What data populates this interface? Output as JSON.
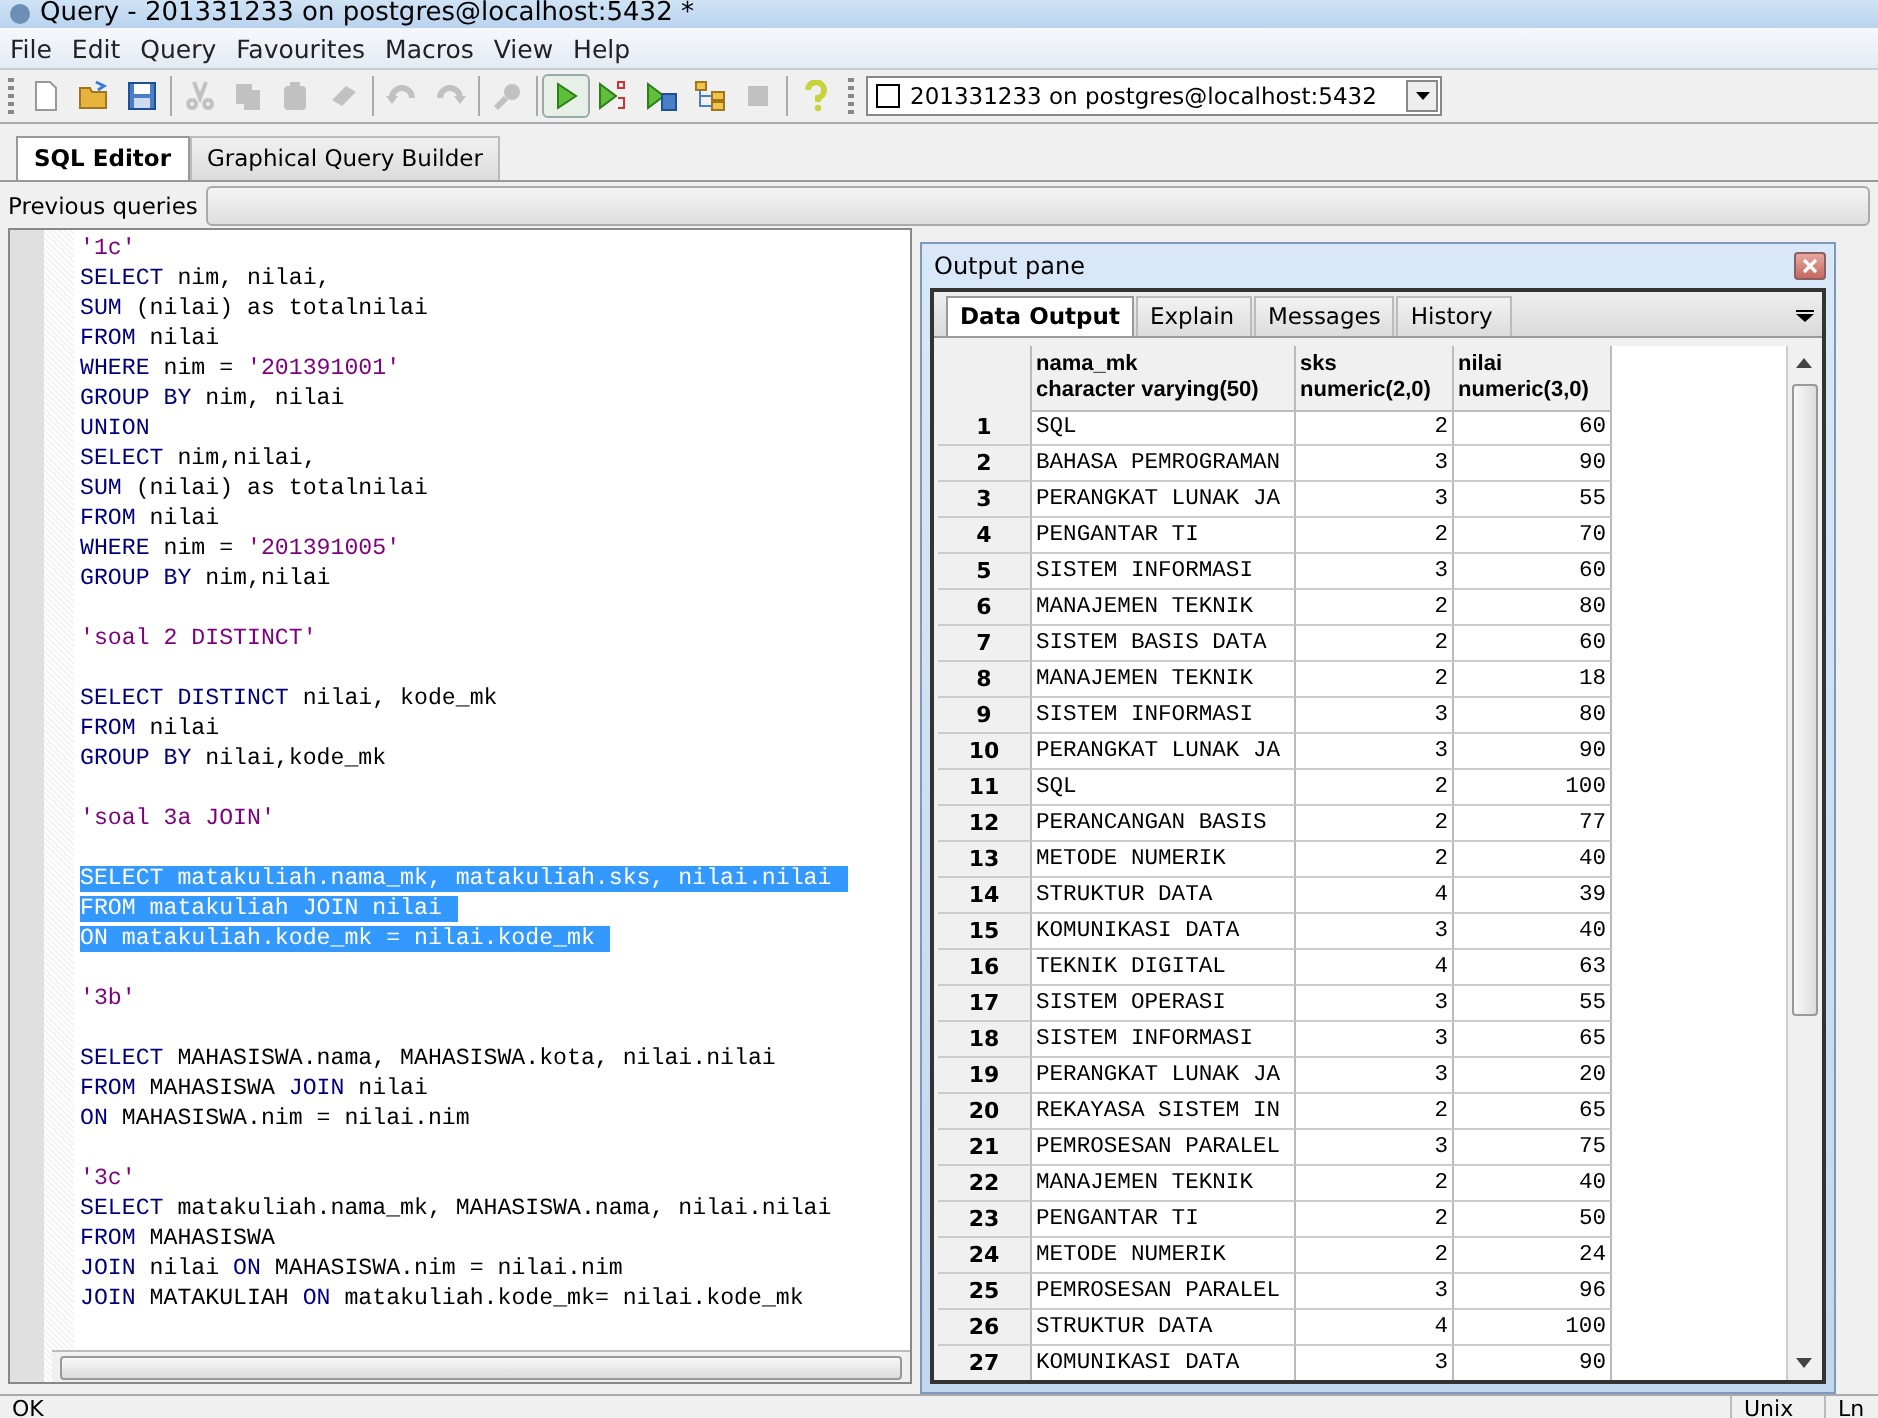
{
  "window": {
    "title": "Query - 201331233 on postgres@localhost:5432 *"
  },
  "menu": [
    "File",
    "Edit",
    "Query",
    "Favourites",
    "Macros",
    "View",
    "Help"
  ],
  "toolbar": [
    {
      "kind": "new",
      "disabled": false
    },
    {
      "kind": "open",
      "disabled": false
    },
    {
      "kind": "save",
      "disabled": false
    },
    {
      "kind": "sep"
    },
    {
      "kind": "cut",
      "disabled": true
    },
    {
      "kind": "copy",
      "disabled": true
    },
    {
      "kind": "paste",
      "disabled": true
    },
    {
      "kind": "clear",
      "disabled": true
    },
    {
      "kind": "sep"
    },
    {
      "kind": "undo",
      "disabled": true
    },
    {
      "kind": "redo",
      "disabled": true
    },
    {
      "kind": "sep"
    },
    {
      "kind": "find",
      "disabled": true
    },
    {
      "kind": "sep"
    },
    {
      "kind": "execute",
      "disabled": false
    },
    {
      "kind": "execute-pgs",
      "disabled": false
    },
    {
      "kind": "execute-file",
      "disabled": false
    },
    {
      "kind": "explain",
      "disabled": false
    },
    {
      "kind": "stop",
      "disabled": true
    },
    {
      "kind": "sep"
    },
    {
      "kind": "help",
      "disabled": false
    }
  ],
  "connection": {
    "value": "201331233 on postgres@localhost:5432"
  },
  "editor_tabs": [
    {
      "label": "SQL Editor",
      "selected": true
    },
    {
      "label": "Graphical Query Builder",
      "selected": false
    }
  ],
  "previous_queries": {
    "label": "Previous queries"
  },
  "code_lines": [
    {
      "kind": "code",
      "selected": false,
      "parts": [
        {
          "kind": "string",
          "text": "'1c'"
        }
      ]
    },
    {
      "kind": "code",
      "selected": false,
      "parts": [
        {
          "kind": "keyword",
          "text": "SELECT"
        },
        {
          "kind": "ident",
          "text": " nim, nilai,"
        }
      ]
    },
    {
      "kind": "code",
      "selected": false,
      "parts": [
        {
          "kind": "keyword",
          "text": "SUM"
        },
        {
          "kind": "ident",
          "text": " (nilai) as totalnilai"
        }
      ]
    },
    {
      "kind": "code",
      "selected": false,
      "parts": [
        {
          "kind": "keyword",
          "text": "FROM"
        },
        {
          "kind": "ident",
          "text": " nilai"
        }
      ]
    },
    {
      "kind": "code",
      "selected": false,
      "parts": [
        {
          "kind": "keyword",
          "text": "WHERE"
        },
        {
          "kind": "ident",
          "text": " nim = "
        },
        {
          "kind": "string",
          "text": "'201391001'"
        }
      ]
    },
    {
      "kind": "code",
      "selected": false,
      "parts": [
        {
          "kind": "keyword",
          "text": "GROUP BY"
        },
        {
          "kind": "ident",
          "text": " nim, nilai"
        }
      ]
    },
    {
      "kind": "code",
      "selected": false,
      "parts": [
        {
          "kind": "keyword",
          "text": "UNION"
        }
      ]
    },
    {
      "kind": "code",
      "selected": false,
      "parts": [
        {
          "kind": "keyword",
          "text": "SELECT"
        },
        {
          "kind": "ident",
          "text": " nim,nilai,"
        }
      ]
    },
    {
      "kind": "code",
      "selected": false,
      "parts": [
        {
          "kind": "keyword",
          "text": "SUM"
        },
        {
          "kind": "ident",
          "text": " (nilai) as totalnilai"
        }
      ]
    },
    {
      "kind": "code",
      "selected": false,
      "parts": [
        {
          "kind": "keyword",
          "text": "FROM"
        },
        {
          "kind": "ident",
          "text": " nilai"
        }
      ]
    },
    {
      "kind": "code",
      "selected": false,
      "parts": [
        {
          "kind": "keyword",
          "text": "WHERE"
        },
        {
          "kind": "ident",
          "text": " nim = "
        },
        {
          "kind": "string",
          "text": "'201391005'"
        }
      ]
    },
    {
      "kind": "code",
      "selected": false,
      "parts": [
        {
          "kind": "keyword",
          "text": "GROUP BY"
        },
        {
          "kind": "ident",
          "text": " nim,nilai"
        }
      ]
    },
    {
      "kind": "blank"
    },
    {
      "kind": "code",
      "selected": false,
      "parts": [
        {
          "kind": "string",
          "text": "'soal 2 DISTINCT'"
        }
      ]
    },
    {
      "kind": "blank"
    },
    {
      "kind": "code",
      "selected": false,
      "parts": [
        {
          "kind": "keyword",
          "text": "SELECT DISTINCT"
        },
        {
          "kind": "ident",
          "text": " nilai, kode_mk"
        }
      ]
    },
    {
      "kind": "code",
      "selected": false,
      "parts": [
        {
          "kind": "keyword",
          "text": "FROM"
        },
        {
          "kind": "ident",
          "text": " nilai"
        }
      ]
    },
    {
      "kind": "code",
      "selected": false,
      "parts": [
        {
          "kind": "keyword",
          "text": "GROUP BY"
        },
        {
          "kind": "ident",
          "text": " nilai,kode_mk"
        }
      ]
    },
    {
      "kind": "blank"
    },
    {
      "kind": "code",
      "selected": false,
      "parts": [
        {
          "kind": "string",
          "text": "'soal 3a JOIN'"
        }
      ]
    },
    {
      "kind": "blank"
    },
    {
      "kind": "code",
      "selected": true,
      "parts": [
        {
          "kind": "keyword",
          "text": "SELECT"
        },
        {
          "kind": "ident",
          "text": " matakuliah.nama_mk, matakuliah.sks, nilai.nilai"
        }
      ]
    },
    {
      "kind": "code",
      "selected": true,
      "parts": [
        {
          "kind": "keyword",
          "text": "FROM"
        },
        {
          "kind": "ident",
          "text": " matakuliah "
        },
        {
          "kind": "keyword",
          "text": "JOIN"
        },
        {
          "kind": "ident",
          "text": " nilai"
        }
      ]
    },
    {
      "kind": "code",
      "selected": true,
      "parts": [
        {
          "kind": "keyword",
          "text": "ON"
        },
        {
          "kind": "ident",
          "text": " matakuliah.kode_mk = nilai.kode_mk"
        }
      ]
    },
    {
      "kind": "blank"
    },
    {
      "kind": "code",
      "selected": false,
      "parts": [
        {
          "kind": "string",
          "text": "'3b'"
        }
      ]
    },
    {
      "kind": "blank"
    },
    {
      "kind": "code",
      "selected": false,
      "parts": [
        {
          "kind": "keyword",
          "text": "SELECT"
        },
        {
          "kind": "ident",
          "text": " MAHASISWA.nama, MAHASISWA.kota, nilai.nilai"
        }
      ]
    },
    {
      "kind": "code",
      "selected": false,
      "parts": [
        {
          "kind": "keyword",
          "text": "FROM"
        },
        {
          "kind": "ident",
          "text": " MAHASISWA "
        },
        {
          "kind": "keyword",
          "text": "JOIN"
        },
        {
          "kind": "ident",
          "text": " nilai"
        }
      ]
    },
    {
      "kind": "code",
      "selected": false,
      "parts": [
        {
          "kind": "keyword",
          "text": "ON"
        },
        {
          "kind": "ident",
          "text": " MAHASISWA.nim = nilai.nim"
        }
      ]
    },
    {
      "kind": "blank"
    },
    {
      "kind": "code",
      "selected": false,
      "parts": [
        {
          "kind": "string",
          "text": "'3c'"
        }
      ]
    },
    {
      "kind": "code",
      "selected": false,
      "parts": [
        {
          "kind": "keyword",
          "text": "SELECT"
        },
        {
          "kind": "ident",
          "text": " matakuliah.nama_mk, MAHASISWA.nama, nilai.nilai"
        }
      ]
    },
    {
      "kind": "code",
      "selected": false,
      "parts": [
        {
          "kind": "keyword",
          "text": "FROM"
        },
        {
          "kind": "ident",
          "text": " MAHASISWA"
        }
      ]
    },
    {
      "kind": "code",
      "selected": false,
      "parts": [
        {
          "kind": "keyword",
          "text": "JOIN"
        },
        {
          "kind": "ident",
          "text": " nilai "
        },
        {
          "kind": "keyword",
          "text": "ON"
        },
        {
          "kind": "ident",
          "text": " MAHASISWA.nim = nilai.nim"
        }
      ]
    },
    {
      "kind": "code",
      "selected": false,
      "parts": [
        {
          "kind": "keyword",
          "text": "JOIN"
        },
        {
          "kind": "ident",
          "text": " MATAKULIAH "
        },
        {
          "kind": "keyword",
          "text": "ON"
        },
        {
          "kind": "ident",
          "text": " matakuliah.kode_mk= nilai.kode_mk"
        }
      ]
    }
  ],
  "output_pane": {
    "title": "Output pane",
    "tabs": [
      {
        "label": "Data Output",
        "selected": true
      },
      {
        "label": "Explain",
        "selected": false
      },
      {
        "label": "Messages",
        "selected": false
      },
      {
        "label": "History",
        "selected": false
      }
    ],
    "columns": [
      {
        "name": "nama_mk",
        "type": "character varying(50)"
      },
      {
        "name": "sks",
        "type": "numeric(2,0)"
      },
      {
        "name": "nilai",
        "type": "numeric(3,0)"
      }
    ],
    "rows": [
      {
        "number": "1",
        "cells": [
          "SQL",
          "2",
          "60"
        ]
      },
      {
        "number": "2",
        "cells": [
          "BAHASA PEMROGRAMAN",
          "3",
          "90"
        ]
      },
      {
        "number": "3",
        "cells": [
          "PERANGKAT LUNAK JA",
          "3",
          "55"
        ]
      },
      {
        "number": "4",
        "cells": [
          "PENGANTAR TI",
          "2",
          "70"
        ]
      },
      {
        "number": "5",
        "cells": [
          "SISTEM INFORMASI",
          "3",
          "60"
        ]
      },
      {
        "number": "6",
        "cells": [
          "MANAJEMEN TEKNIK",
          "2",
          "80"
        ]
      },
      {
        "number": "7",
        "cells": [
          "SISTEM BASIS DATA",
          "2",
          "60"
        ]
      },
      {
        "number": "8",
        "cells": [
          "MANAJEMEN TEKNIK",
          "2",
          "18"
        ]
      },
      {
        "number": "9",
        "cells": [
          "SISTEM INFORMASI",
          "3",
          "80"
        ]
      },
      {
        "number": "10",
        "cells": [
          "PERANGKAT LUNAK JA",
          "3",
          "90"
        ]
      },
      {
        "number": "11",
        "cells": [
          "SQL",
          "2",
          "100"
        ]
      },
      {
        "number": "12",
        "cells": [
          "PERANCANGAN BASIS",
          "2",
          "77"
        ]
      },
      {
        "number": "13",
        "cells": [
          "METODE NUMERIK",
          "2",
          "40"
        ]
      },
      {
        "number": "14",
        "cells": [
          "STRUKTUR DATA",
          "4",
          "39"
        ]
      },
      {
        "number": "15",
        "cells": [
          "KOMUNIKASI DATA",
          "3",
          "40"
        ]
      },
      {
        "number": "16",
        "cells": [
          "TEKNIK DIGITAL",
          "4",
          "63"
        ]
      },
      {
        "number": "17",
        "cells": [
          "SISTEM OPERASI",
          "3",
          "55"
        ]
      },
      {
        "number": "18",
        "cells": [
          "SISTEM INFORMASI",
          "3",
          "65"
        ]
      },
      {
        "number": "19",
        "cells": [
          "PERANGKAT LUNAK JA",
          "3",
          "20"
        ]
      },
      {
        "number": "20",
        "cells": [
          "REKAYASA SISTEM IN",
          "2",
          "65"
        ]
      },
      {
        "number": "21",
        "cells": [
          "PEMROSESAN PARALEL",
          "3",
          "75"
        ]
      },
      {
        "number": "22",
        "cells": [
          "MANAJEMEN TEKNIK",
          "2",
          "40"
        ]
      },
      {
        "number": "23",
        "cells": [
          "PENGANTAR TI",
          "2",
          "50"
        ]
      },
      {
        "number": "24",
        "cells": [
          "METODE NUMERIK",
          "2",
          "24"
        ]
      },
      {
        "number": "25",
        "cells": [
          "PEMROSESAN PARALEL",
          "3",
          "96"
        ]
      },
      {
        "number": "26",
        "cells": [
          "STRUKTUR DATA",
          "4",
          "100"
        ]
      },
      {
        "number": "27",
        "cells": [
          "KOMUNIKASI DATA",
          "3",
          "90"
        ]
      }
    ]
  },
  "status_bar": [
    "OK",
    "Unix",
    "Ln"
  ]
}
